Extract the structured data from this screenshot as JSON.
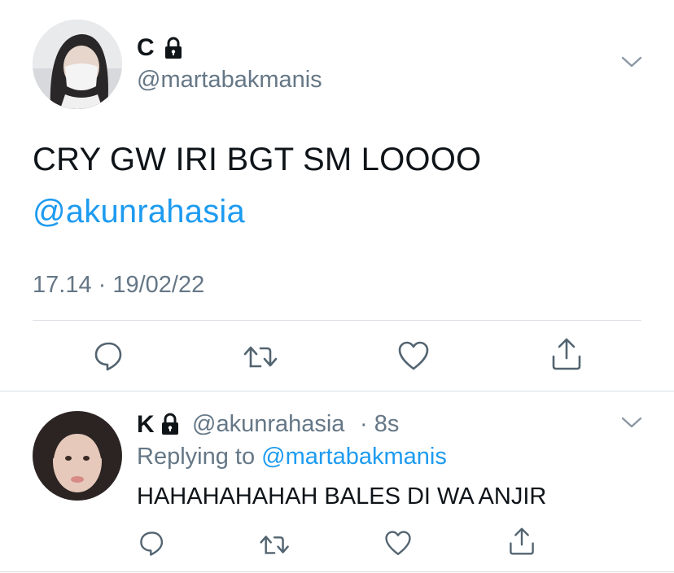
{
  "main_tweet": {
    "display_name": "C",
    "handle": "@martabakmanis",
    "text": "CRY GW IRI BGT SM LOOOO",
    "mention": "@akunrahasia",
    "timestamp": "17.14 · 19/02/22"
  },
  "reply_tweet": {
    "display_name": "K",
    "handle": "@akunrahasia",
    "time_ago": "· 8s",
    "replying_prefix": "Replying to",
    "replying_to": "@martabakmanis",
    "text": "HAHAHAHAHAH BALES DI WA ANJIR"
  },
  "icons": {
    "reply": "comment-icon",
    "retweet": "retweet-icon",
    "like": "heart-icon",
    "share": "share-icon",
    "lock": "lock-icon",
    "more": "chevron-down-icon"
  },
  "colors": {
    "accent": "#1d9bf0",
    "secondary_text": "#657786",
    "icon": "#536471",
    "divider": "#d9dee2"
  }
}
